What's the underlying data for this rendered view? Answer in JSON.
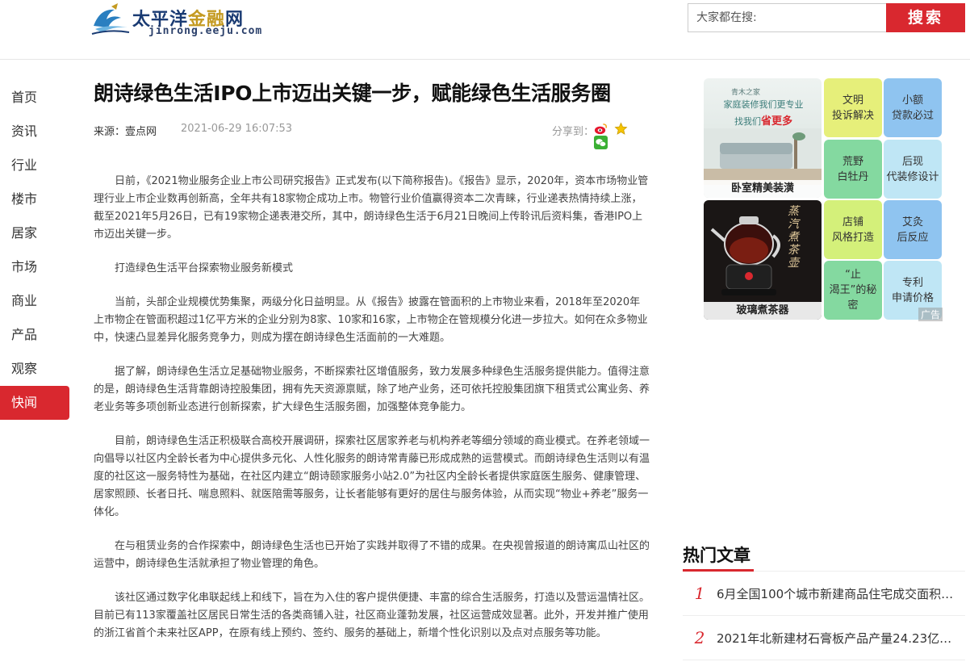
{
  "header": {
    "logo_cn": "太平洋",
    "logo_cn_gold": "金融",
    "logo_cn_end": "网",
    "logo_sub": "jinrong.eeju.com",
    "search_placeholder": "大家都在搜:",
    "search_button": "搜索"
  },
  "nav": {
    "items": [
      "首页",
      "资讯",
      "行业",
      "楼市",
      "居家",
      "市场",
      "商业",
      "产品",
      "观察",
      "快闻"
    ],
    "active": "快闻"
  },
  "article": {
    "title": "朗诗绿色生活IPO上市迈出关键一步，赋能绿色生活服务圈",
    "source": "来源：壹点网",
    "date": "2021-06-29 16:07:53",
    "share_label": "分享到：",
    "paragraphs": [
      "日前，《2021物业服务企业上市公司研究报告》正式发布(以下简称报告)。《报告》显示，2020年，资本市场物业管理行业上市企业数再创新高，全年共有18家物企成功上市。物管行业价值赢得资本二次青睐，行业递表热情持续上涨，截至2021年5月26日，已有19家物企递表港交所，其中，朗诗绿色生活于6月21日晚间上传聆讯后资料集，香港IPO上市迈出关键一步。",
      "打造绿色生活平台探索物业服务新模式",
      "当前，头部企业规模优势集聚，两级分化日益明显。从《报告》披露在管面积的上市物业来看，2018年至2020年上市物企在管面积超过1亿平方米的企业分别为8家、10家和16家，上市物企在管规模分化进一步拉大。如何在众多物业中，快速凸显差异化服务竞争力，则成为摆在朗诗绿色生活面前的一大难题。",
      "据了解，朗诗绿色生活立足基础物业服务，不断探索社区增值服务，致力发展多种绿色生活服务提供能力。值得注意的是，朗诗绿色生活背靠朗诗控股集团，拥有先天资源禀赋，除了地产业务，还可依托控股集团旗下租赁式公寓业务、养老业务等多项创新业态进行创新探索，扩大绿色生活服务圈，加强整体竞争能力。",
      "目前，朗诗绿色生活正积极联合高校开展调研，探索社区居家养老与机构养老等细分领域的商业模式。在养老领域一向倡导以社区内全龄长者为中心提供多元化、人性化服务的朗诗常青藤已形成成熟的运营模式。而朗诗绿色生活则以有温度的社区这一服务特性为基础，在社区内建立“朗诗颐家服务小站2.0”为社区内全龄长者提供家庭医生服务、健康管理、居家照顾、长者日托、喘息照料、就医陪需等服务，让长者能够有更好的居住与服务体验，从而实现“物业+养老”服务一体化。",
      "在与租赁业务的合作探索中，朗诗绿色生活也已开始了实践并取得了不错的成果。在央视曾报道的朗诗寓瓜山社区的运营中，朗诗绿色生活就承担了物业管理的角色。",
      "该社区通过数字化串联起线上和线下，旨在为入住的客户提供便捷、丰富的综合生活服务，打造以及营运温情社区。目前已有113家覆盖社区居民日常生活的各类商铺入驻，社区商业蓬勃发展，社区运营成效显著。此外，开发并推广使用的浙江省首个未来社区APP，在原有线上预约、签约、服务的基础上，新增个性化识别以及点对点服务等功能。"
    ]
  },
  "ads": {
    "image1_caption": "卧室精美装潢",
    "image1_line1": "家庭装修我们更专业",
    "image1_line2": "找我们",
    "image1_line2_red": "省更多",
    "image1_tag": "青木之家",
    "image2_caption": "玻璃煮茶器",
    "image2_text": "蒸汽煮茶壶",
    "tiles": [
      {
        "text": "文明\n投诉解决",
        "color": "#e6ef7a"
      },
      {
        "text": "小额\n贷款必过",
        "color": "#8fc4f0"
      },
      {
        "text": "荒野\n白牡丹",
        "color": "#84d9a0"
      },
      {
        "text": "后现\n代装修设计",
        "color": "#bfe6f5"
      },
      {
        "text": "店铺\n风格打造",
        "color": "#d4f07a"
      },
      {
        "text": "艾灸\n后反应",
        "color": "#8fc4f0"
      },
      {
        "text": "“止\n渴王”的秘\n密",
        "color": "#84d9a0"
      },
      {
        "text": "专利\n申请价格",
        "color": "#bfe6f5"
      }
    ],
    "ad_label": "广告"
  },
  "hot": {
    "title": "热门文章",
    "items": [
      {
        "num": "1",
        "text": "6月全国100个城市新建商品住宅成交面积…"
      },
      {
        "num": "2",
        "text": "2021年北新建材石膏板产品产量24.23亿…"
      }
    ]
  }
}
